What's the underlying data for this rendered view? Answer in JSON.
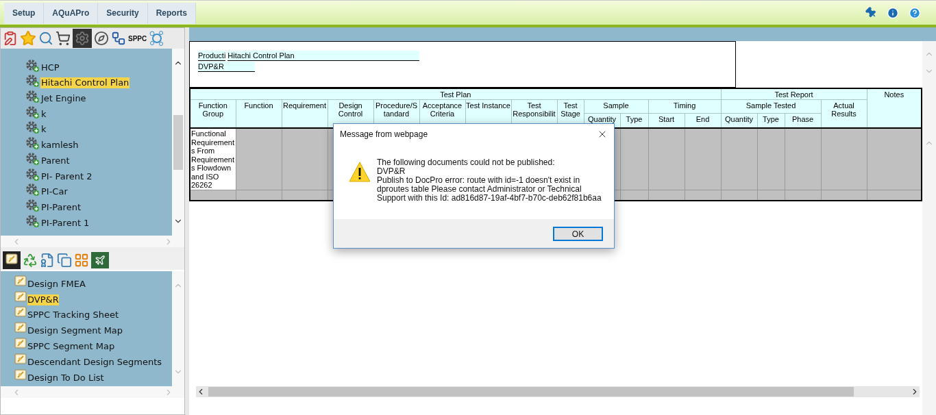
{
  "menu": [
    {
      "label": "Setup"
    },
    {
      "label": "AQuAPro"
    },
    {
      "label": "Security"
    },
    {
      "label": "Reports"
    }
  ],
  "toolbar": {
    "label": "SPPC"
  },
  "tree": {
    "items": [
      {
        "label": "HCP",
        "selected": false
      },
      {
        "label": "Hitachi Control Plan",
        "selected": true
      },
      {
        "label": "Jet Engine",
        "selected": false
      },
      {
        "label": "k",
        "selected": false
      },
      {
        "label": "k",
        "selected": false
      },
      {
        "label": "kamlesh",
        "selected": false
      },
      {
        "label": "Parent",
        "selected": false
      },
      {
        "label": "PI- Parent 2",
        "selected": false
      },
      {
        "label": "PI-Car",
        "selected": false
      },
      {
        "label": "PI-Parent",
        "selected": false
      },
      {
        "label": "PI-Parent 1",
        "selected": false
      }
    ]
  },
  "documents": {
    "items": [
      {
        "label": "Design FMEA",
        "selected": false
      },
      {
        "label": "DVP&R",
        "selected": true
      },
      {
        "label": "SPPC Tracking Sheet",
        "selected": false
      },
      {
        "label": "Design Segment Map",
        "selected": false
      },
      {
        "label": "SPPC Segment Map",
        "selected": false
      },
      {
        "label": "Descendant Design Segments",
        "selected": false
      },
      {
        "label": "Design To Do List",
        "selected": false
      }
    ]
  },
  "document_header": {
    "product_label": "Producti",
    "product_value": "Hitachi Control Plan",
    "document_value": "DVP&R"
  },
  "table": {
    "columns": [
      {
        "label": "Test Plan",
        "children": [
          {
            "label": "Function Group"
          },
          {
            "label": "Function"
          },
          {
            "label": "Requirement"
          },
          {
            "label": "Design Control"
          },
          {
            "label": "Procedure/S tandard"
          },
          {
            "label": "Acceptance Criteria"
          },
          {
            "label": "Test Instance"
          },
          {
            "label": "Test Responsibilit"
          },
          {
            "label": "Test Stage"
          },
          {
            "label": "Sample",
            "children": [
              {
                "label": "Quantity"
              },
              {
                "label": "Type"
              }
            ]
          },
          {
            "label": "Timing",
            "children": [
              {
                "label": "Start"
              },
              {
                "label": "End"
              }
            ]
          }
        ]
      },
      {
        "label": "Test Report",
        "children": [
          {
            "label": "Sample Tested",
            "children": [
              {
                "label": "Quantity"
              },
              {
                "label": "Type"
              },
              {
                "label": "Phase"
              }
            ]
          },
          {
            "label": "Actual Results"
          }
        ]
      },
      {
        "label": "Notes"
      }
    ],
    "rows": [
      {
        "cells": [
          "Functional Requirements From Requirements Flowdown and ISO 26262"
        ]
      }
    ]
  },
  "dialog": {
    "title": "Message from webpage",
    "lines": [
      "The following documents could not be published:",
      "DVP&R",
      "Publish to DocPro error: route with id=-1 doesn't exist in dproutes table Please contact Administrator or Technical Support with this Id: ad816d87-19af-4bf7-b70c-deb62f81b6aa"
    ],
    "button": "OK"
  }
}
